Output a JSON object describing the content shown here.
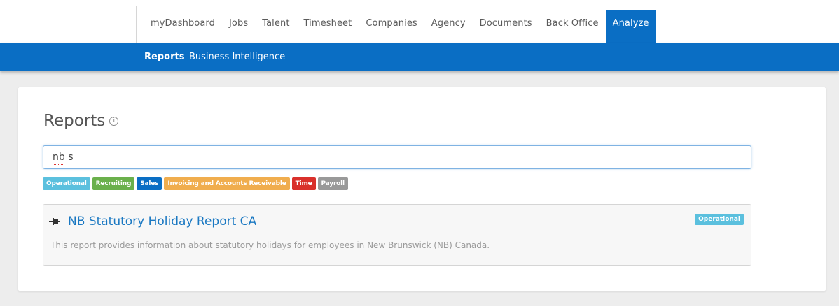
{
  "topnav": {
    "tabs": [
      {
        "label": "myDashboard"
      },
      {
        "label": "Jobs"
      },
      {
        "label": "Talent"
      },
      {
        "label": "Timesheet"
      },
      {
        "label": "Companies"
      },
      {
        "label": "Agency"
      },
      {
        "label": "Documents"
      },
      {
        "label": "Back Office"
      },
      {
        "label": "Analyze",
        "active": true
      }
    ]
  },
  "subnav": {
    "reports": "Reports",
    "business_intelligence": "Business Intelligence"
  },
  "page": {
    "title": "Reports",
    "info_icon_glyph": "i"
  },
  "search": {
    "value": "nb s"
  },
  "tags": [
    {
      "label": "Operational",
      "color": "#5bc0de"
    },
    {
      "label": "Recruiting",
      "color": "#6ab04c"
    },
    {
      "label": "Sales",
      "color": "#0a6ec4"
    },
    {
      "label": "Invoicing and Accounts Receivable",
      "color": "#f0ad4e"
    },
    {
      "label": "Time",
      "color": "#d9302b"
    },
    {
      "label": "Payroll",
      "color": "#999999"
    }
  ],
  "result": {
    "title": "NB Statutory Holiday Report CA",
    "description": "This report provides information about statutory holidays for employees in New Brunswick (NB) Canada.",
    "badge": "Operational",
    "badge_color": "#5bc0de",
    "icon": "pin-icon"
  }
}
